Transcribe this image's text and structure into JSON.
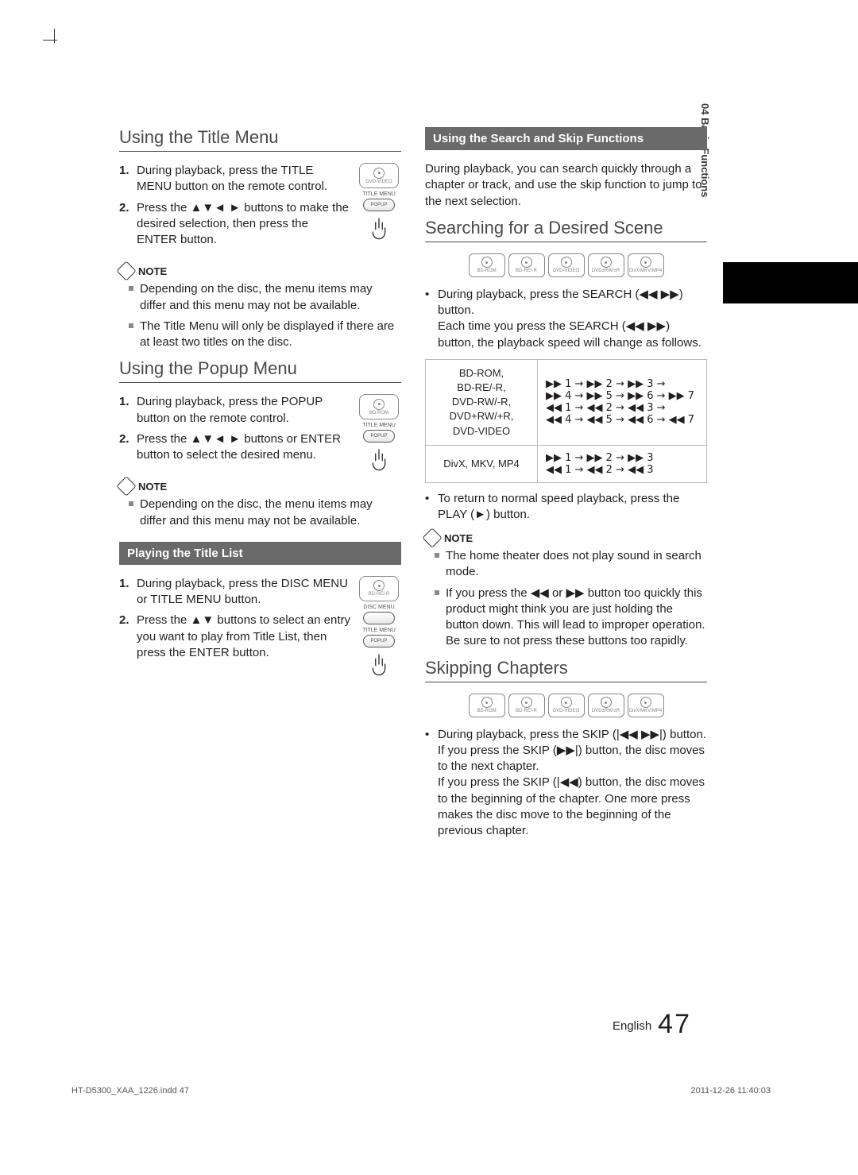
{
  "sideTab": "04  Basic Functions",
  "left": {
    "h1": "Using the Title Menu",
    "steps1": [
      "During playback, press the TITLE MENU button on the remote control.",
      "Press the ▲▼◄ ► buttons to make the desired selection, then press the ENTER button."
    ],
    "note1Label": "NOTE",
    "note1Items": [
      "Depending on the disc, the menu items may differ and this menu may not be available.",
      "The Title Menu will only be displayed if there are at least two titles on the disc."
    ],
    "h2": "Using the Popup Menu",
    "steps2": [
      "During playback, press the POPUP button on the remote control.",
      "Press the ▲▼◄ ► buttons or ENTER button to select the desired menu."
    ],
    "note2Label": "NOTE",
    "note2Items": [
      "Depending on the disc, the menu items may differ and this menu may not be available."
    ],
    "sub1": "Playing the Title List",
    "steps3": [
      "During playback, press the DISC MENU or TITLE MENU button.",
      "Press the ▲▼ buttons to select an entry you want to play from Title List, then press the ENTER button."
    ],
    "discLabels": {
      "dvdvideo": "DVD-VIDEO",
      "bdrom": "BD-ROM",
      "bdrer": "BD-RE/-R"
    },
    "btnLabels": {
      "titleMenu": "TITLE MENU",
      "popup": "POPUP",
      "discMenu": "DISC MENU"
    }
  },
  "right": {
    "sub1": "Using the Search and Skip Functions",
    "intro": "During playback, you can search quickly through a chapter or track, and use the skip function to jump to the next selection.",
    "h1": "Searching for a Desired Scene",
    "discRow1": [
      "BD-ROM",
      "BD-RE/-R",
      "DVD-VIDEO",
      "DVD±RW/±R",
      "DivX/MKV/MP4"
    ],
    "bullets1": [
      "During playback, press the SEARCH (◀◀ ▶▶) button.\nEach time you press the SEARCH (◀◀ ▶▶) button, the playback speed will change as follows."
    ],
    "table": {
      "r1c1": "BD-ROM,\nBD-RE/-R,\nDVD-RW/-R,\nDVD+RW/+R,\nDVD-VIDEO",
      "r1c2": "▶▶ 1 → ▶▶ 2 → ▶▶ 3 →\n▶▶ 4 → ▶▶ 5 → ▶▶ 6 → ▶▶ 7\n◀◀ 1 → ◀◀ 2 → ◀◀ 3 →\n◀◀ 4 → ◀◀ 5 → ◀◀ 6 → ◀◀ 7",
      "r2c1": "DivX, MKV, MP4",
      "r2c2": "▶▶ 1 → ▶▶ 2 → ▶▶ 3\n◀◀ 1 → ◀◀ 2 → ◀◀ 3"
    },
    "bullets2": [
      "To return to normal speed playback, press the PLAY (►) button."
    ],
    "note1Label": "NOTE",
    "note1Items": [
      "The home theater does not play sound in search mode.",
      "If you press the ◀◀ or ▶▶ button too quickly this product might think you are just holding the button down. This will lead to improper operation. Be sure to not press these buttons too rapidly."
    ],
    "h2": "Skipping Chapters",
    "discRow2": [
      "BD-ROM",
      "BD-RE/-R",
      "DVD-VIDEO",
      "DVD±RW/±R",
      "DivX/MKV/MP4"
    ],
    "bullets3": [
      "During playback, press the SKIP (|◀◀ ▶▶|) button.\nIf you press the SKIP (▶▶|) button, the disc moves to the next chapter.\nIf you press the SKIP (|◀◀) button, the disc moves to the beginning of the chapter. One more press makes the disc move to the beginning of the previous chapter."
    ]
  },
  "footer": {
    "lang": "English",
    "page": "47",
    "leftMeta": "HT-D5300_XAA_1226.indd   47",
    "rightMeta": "2011-12-26     11:40:03"
  }
}
